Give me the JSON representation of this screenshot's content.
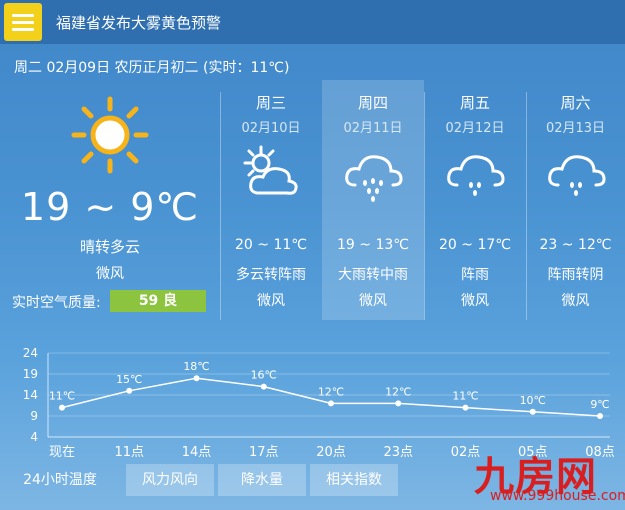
{
  "header": {
    "alert_title": "福建省发布大雾黄色预警"
  },
  "today": {
    "date_line": "周二 02月09日 农历正月初二 (实时：11℃)",
    "temp_range": "19 ~ 9℃",
    "condition": "晴转多云",
    "wind": "微风",
    "aqi_label": "实时空气质量:",
    "aqi_value": "59 良",
    "aqi_color": "#8cc43f",
    "icon": "sun-icon"
  },
  "forecast": [
    {
      "weekday": "周三",
      "date": "02月10日",
      "temp": "20 ~ 11℃",
      "condition": "多云转阵雨",
      "wind": "微风",
      "icon": "partly-cloudy-icon"
    },
    {
      "weekday": "周四",
      "date": "02月11日",
      "temp": "19 ~ 13℃",
      "condition": "大雨转中雨",
      "wind": "微风",
      "icon": "rain-cloud-icon"
    },
    {
      "weekday": "周五",
      "date": "02月12日",
      "temp": "20 ~ 17℃",
      "condition": "阵雨",
      "wind": "微风",
      "icon": "rain-cloud-icon"
    },
    {
      "weekday": "周六",
      "date": "02月13日",
      "temp": "23 ~ 12℃",
      "condition": "阵雨转阴",
      "wind": "微风",
      "icon": "rain-cloud-icon"
    }
  ],
  "chart_data": {
    "type": "line",
    "categories": [
      "现在",
      "11点",
      "14点",
      "17点",
      "20点",
      "23点",
      "02点",
      "05点",
      "08点"
    ],
    "values": [
      11,
      15,
      18,
      16,
      12,
      12,
      11,
      10,
      9
    ],
    "value_labels": [
      "11℃",
      "15℃",
      "18℃",
      "16℃",
      "12℃",
      "12℃",
      "11℃",
      "10℃",
      "9℃"
    ],
    "yticks": [
      "24",
      "19",
      "14",
      "9",
      "4"
    ],
    "ylim": [
      4,
      24
    ],
    "grid": true
  },
  "tabs": [
    "24小时温度",
    "风力风向",
    "降水量",
    "相关指数"
  ],
  "watermark": {
    "brand": "九房网",
    "url": "www.999house.com"
  },
  "colors": {
    "accent": "#f3d11a",
    "background": "#4a93d2",
    "watermark": "#d81e1e"
  }
}
